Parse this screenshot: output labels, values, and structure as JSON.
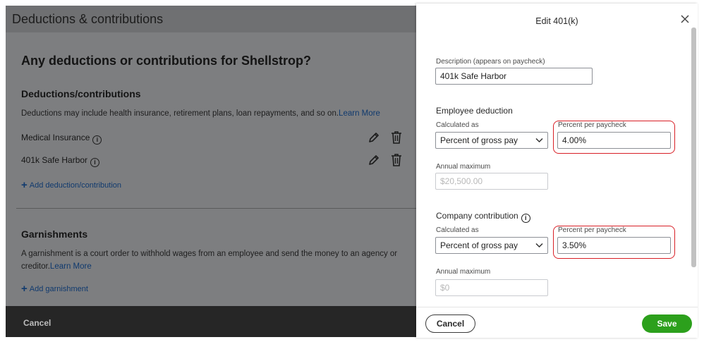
{
  "left": {
    "header_title": "Deductions & contributions",
    "heading": "Any deductions or contributions for Shellstrop?",
    "deductions": {
      "title": "Deductions/contributions",
      "description": "Deductions may include health insurance, retirement plans, loan repayments, and so on.",
      "learn_more": "Learn More",
      "items": [
        {
          "label": "Medical Insurance"
        },
        {
          "label": "401k Safe Harbor"
        }
      ],
      "add_label": "Add deduction/contribution"
    },
    "garnishments": {
      "title": "Garnishments",
      "description_line1": "A garnishment is a court order to withhold wages from an employee and send the money to an agency or",
      "description_line2": "creditor.",
      "learn_more": "Learn More",
      "add_label": "Add garnishment"
    },
    "footer_cancel": "Cancel"
  },
  "drawer": {
    "title": "Edit 401(k)",
    "description_label": "Description (appears on paycheck)",
    "description_value": "401k Safe Harbor",
    "employee": {
      "title": "Employee deduction",
      "calc_label": "Calculated as",
      "calc_value": "Percent of gross pay",
      "percent_label": "Percent per paycheck",
      "percent_value": "4.00%",
      "annual_label": "Annual maximum",
      "annual_value": "$20,500.00"
    },
    "company": {
      "title": "Company contribution",
      "calc_label": "Calculated as",
      "calc_value": "Percent of gross pay",
      "percent_label": "Percent per paycheck",
      "percent_value": "3.50%",
      "annual_label": "Annual maximum",
      "annual_value": "$0"
    },
    "cancel_label": "Cancel",
    "save_label": "Save"
  },
  "colors": {
    "accent_green": "#2ca01c",
    "highlight_red": "#d81f26",
    "link_blue": "#103a6e"
  }
}
